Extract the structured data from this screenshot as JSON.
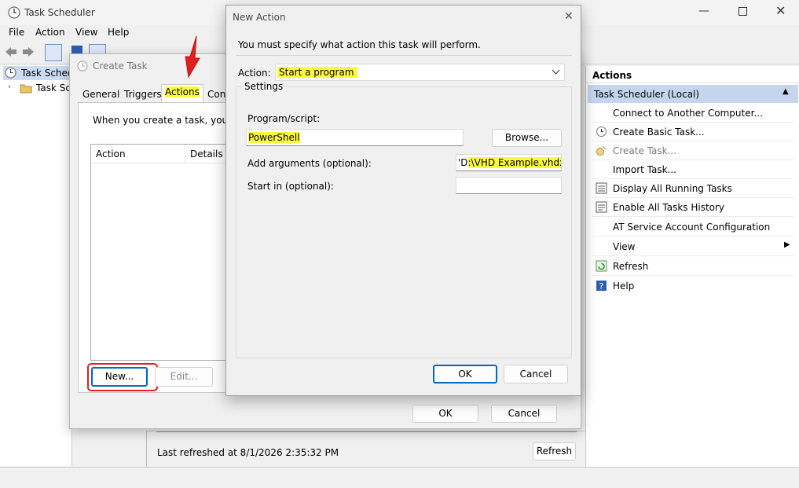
{
  "main_window": {
    "title": "Task Scheduler",
    "menu": [
      "File",
      "Action",
      "View",
      "Help"
    ],
    "tree": {
      "root": "Task Schedule",
      "child": "Task Sche"
    },
    "status": {
      "last_refreshed": "Last refreshed at 8/1/2026 2:35:32 PM",
      "refresh_button": "Refresh"
    }
  },
  "actions_pane": {
    "header": "Actions",
    "section": "Task Scheduler (Local)",
    "items": [
      {
        "label": "Connect to Another Computer...",
        "icon": "none"
      },
      {
        "label": "Create Basic Task...",
        "icon": "clock-icon"
      },
      {
        "label": "Create Task...",
        "icon": "task-icon"
      },
      {
        "label": "Import Task...",
        "icon": "none"
      },
      {
        "label": "Display All Running Tasks",
        "icon": "list-icon"
      },
      {
        "label": "Enable All Tasks History",
        "icon": "history-icon"
      },
      {
        "label": "AT Service Account Configuration",
        "icon": "none"
      },
      {
        "label": "View",
        "icon": "none"
      },
      {
        "label": "Refresh",
        "icon": "refresh-icon"
      },
      {
        "label": "Help",
        "icon": "help-icon"
      }
    ]
  },
  "create_task": {
    "title": "Create Task",
    "tabs": [
      "General",
      "Triggers",
      "Actions",
      "Con"
    ],
    "intro": "When you create a task, you mu",
    "columns": [
      "Action",
      "Details"
    ],
    "buttons": {
      "new": "New...",
      "edit": "Edit...",
      "ok": "OK",
      "cancel": "Cancel"
    }
  },
  "new_action": {
    "title": "New Action",
    "instruction": "You must specify what action this task will perform.",
    "action_label": "Action:",
    "action_value": "Start a program",
    "settings_label": "Settings",
    "program_label": "Program/script:",
    "program_value": "PowerShell",
    "browse": "Browse...",
    "args_label": "Add arguments (optional):",
    "args_prefix": "'D",
    "args_highlight": ":\\VHD Example.vhdx",
    "args_suffix": "'\"",
    "startin_label": "Start in (optional):",
    "startin_value": "",
    "ok": "OK",
    "cancel": "Cancel"
  },
  "colors": {
    "highlight": "#fbfb3c",
    "accent": "#0067c0",
    "annotation_red": "#e02020",
    "section_header": "#c5d5ee"
  }
}
